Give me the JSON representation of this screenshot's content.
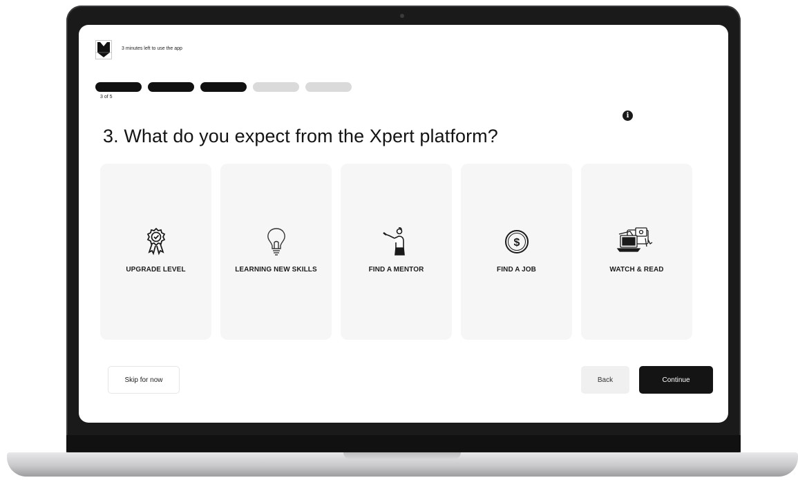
{
  "app": {
    "timer_text": "3 minutes left to use the app"
  },
  "progress": {
    "current_step": 3,
    "total_steps": 5,
    "step_label": "3 of 5"
  },
  "question": {
    "title": "3. What do you expect from the Xpert platform?"
  },
  "options": [
    {
      "label": "UPGRADE LEVEL",
      "icon": "award-badge-icon"
    },
    {
      "label": "LEARNING NEW SKILLS",
      "icon": "lightbulb-icon"
    },
    {
      "label": "FIND A MENTOR",
      "icon": "mentor-person-icon"
    },
    {
      "label": "FIND A JOB",
      "icon": "dollar-coin-icon"
    },
    {
      "label": "WATCH & READ",
      "icon": "media-devices-icon"
    }
  ],
  "buttons": {
    "skip_label": "Skip for now",
    "back_label": "Back",
    "continue_label": "Continue"
  },
  "colors": {
    "accent": "#141414",
    "progress_inactive": "#dadada",
    "card_background": "#f6f6f6"
  }
}
